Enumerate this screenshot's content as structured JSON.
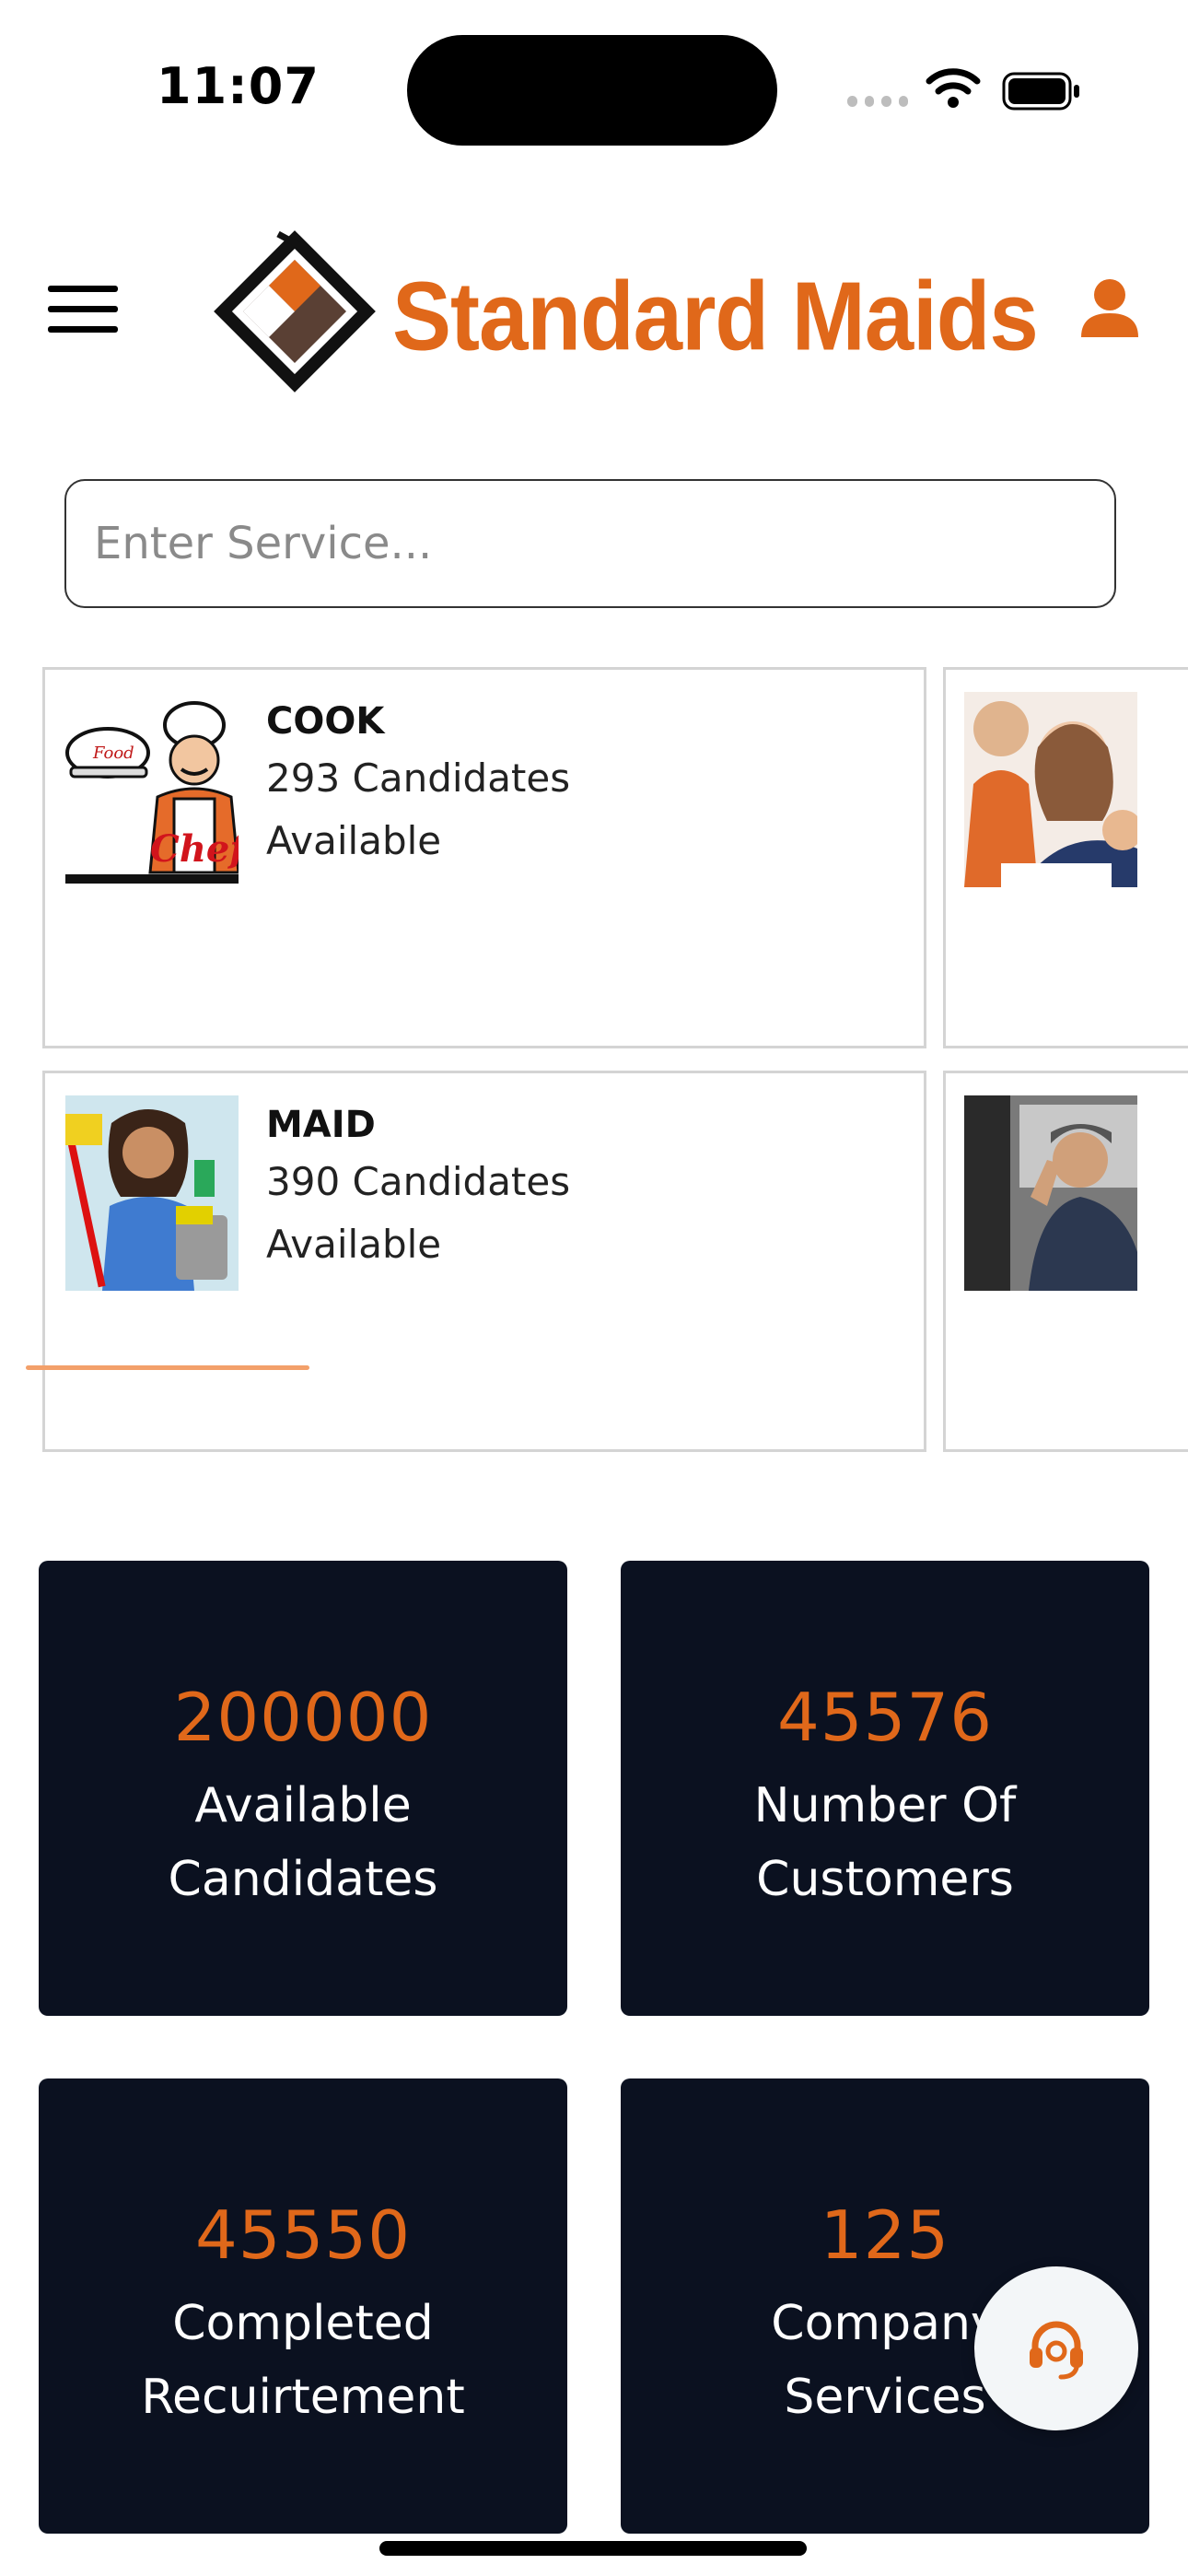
{
  "status_bar": {
    "time": "11:07"
  },
  "header": {
    "logo_text": "Standard Maids",
    "menu_icon": "hamburger-menu-icon",
    "profile_icon": "user-icon",
    "brand_color": "#e0681a"
  },
  "search": {
    "placeholder": "Enter Service..."
  },
  "services": [
    {
      "title": "COOK",
      "count_text": "293 Candidates",
      "status": "Available",
      "image": "chef-illustration"
    },
    {
      "title": "",
      "count_text": "",
      "status": "",
      "image": "tutor-with-children-photo"
    },
    {
      "title": "MAID",
      "count_text": "390 Candidates",
      "status": "Available",
      "image": "maid-with-cleaning-supplies-photo"
    },
    {
      "title": "",
      "count_text": "",
      "status": "",
      "image": "driver-in-vehicle-photo"
    }
  ],
  "stats": [
    {
      "value": "200000",
      "label": "Available Candidates"
    },
    {
      "value": "45576",
      "label": "Number Of Customers"
    },
    {
      "value": "45550",
      "label": "Completed Recuirtement"
    },
    {
      "value": "125",
      "label": "Company Services"
    }
  ],
  "colors": {
    "accent": "#e0681a",
    "tile_background": "#0b1120"
  },
  "support": {
    "icon": "headset-support-icon"
  }
}
